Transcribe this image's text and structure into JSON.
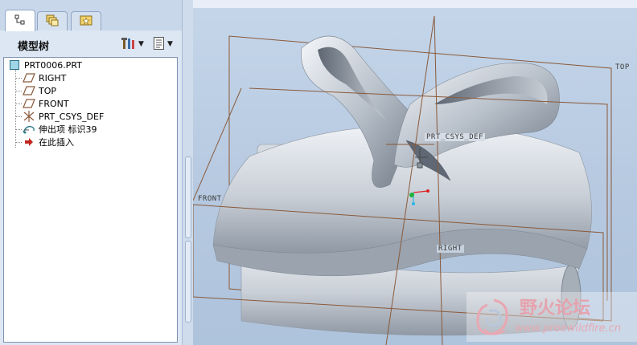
{
  "panel": {
    "title": "模型树",
    "tabs": [
      {
        "name": "model-tree-tab",
        "icon": "tree-icon",
        "active": true
      },
      {
        "name": "layers-tab",
        "icon": "layers-icon",
        "active": false
      },
      {
        "name": "favorites-tab",
        "icon": "star-folder-icon",
        "active": false
      }
    ],
    "header_buttons": [
      {
        "name": "settings-button",
        "icon": "tools-icon"
      },
      {
        "name": "show-button",
        "icon": "list-icon"
      }
    ]
  },
  "tree": {
    "root": "PRT0006.PRT",
    "items": [
      {
        "label": "RIGHT",
        "icon": "datum-plane-icon"
      },
      {
        "label": "TOP",
        "icon": "datum-plane-icon"
      },
      {
        "label": "FRONT",
        "icon": "datum-plane-icon"
      },
      {
        "label": "PRT_CSYS_DEF",
        "icon": "coord-system-icon"
      },
      {
        "label": "伸出项  标识39",
        "icon": "protrusion-icon"
      },
      {
        "label": "在此插入",
        "icon": "insert-arrow-icon"
      }
    ]
  },
  "viewport": {
    "datum_labels": {
      "top": "TOP",
      "front": "FRONT",
      "right": "RIGHT",
      "csys": "PRT_CSYS_DEF"
    },
    "watermark": {
      "title": "野火论坛",
      "url": "www.proewildfire.cn"
    }
  },
  "colors": {
    "datum": "#8a5a3a",
    "model": "#c8ced6",
    "tree_bg": "#ffffff",
    "panel_bg": "#dde7f3"
  }
}
